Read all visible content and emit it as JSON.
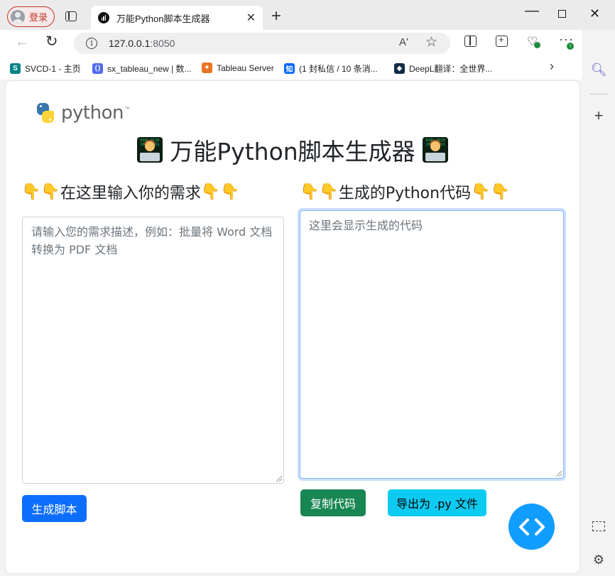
{
  "browser": {
    "profile_label": "登录",
    "tab": {
      "title": "万能Python脚本生成器",
      "close": "✕"
    },
    "new_tab": "+",
    "window": {
      "minimize": "—",
      "close": "✕"
    },
    "url_host": "127.0.0.1",
    "url_port": ":8050",
    "read_aloud": "Aʹ",
    "favorite": "☆",
    "bookmarks": [
      {
        "label": "SVCD-1 - 主页",
        "icon": "sharepoint-icon",
        "color": "#038387",
        "glyph": "S"
      },
      {
        "label": "sx_tableau_new | 数...",
        "icon": "code-bracket-icon",
        "color": "#4f6bed",
        "glyph": "⟨⟩"
      },
      {
        "label": "Tableau Server",
        "icon": "tableau-icon",
        "color": "#e97627",
        "glyph": "✦"
      },
      {
        "label": "(1 封私信 / 10 条消...",
        "icon": "zhihu-icon",
        "color": "#0066ff",
        "glyph": "知"
      },
      {
        "label": "DeepL翻译：全世界...",
        "icon": "deepl-icon",
        "color": "#0f2b46",
        "glyph": "◆"
      }
    ],
    "bookmarks_more": "›"
  },
  "page": {
    "logo_text": "python",
    "logo_tm": "™",
    "title": "万能Python脚本生成器",
    "input_label": "在这里输入你的需求",
    "input_placeholder": "请输入您的需求描述，例如：批量将 Word 文档转换为 PDF 文档",
    "output_label": "生成的Python代码",
    "output_placeholder": "这里会显示生成的代码",
    "hand_glyph": "👇",
    "buttons": {
      "generate": "生成脚本",
      "copy": "复制代码",
      "export": "导出为 .py 文件"
    },
    "fab_label": "‹ ›"
  },
  "colors": {
    "primary": "#0d6efd",
    "success": "#198754",
    "info": "#0dcaf0",
    "fab": "#119dff"
  }
}
